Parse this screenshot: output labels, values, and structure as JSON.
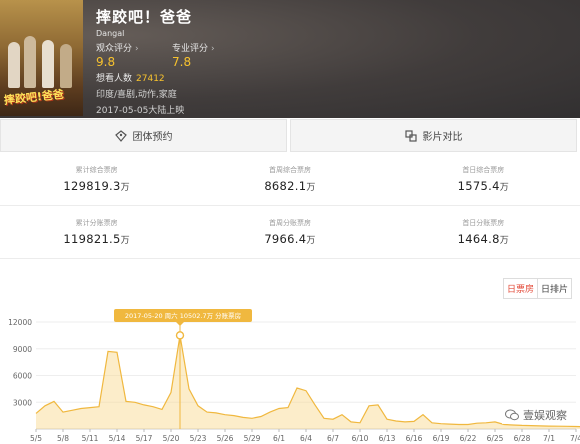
{
  "movie": {
    "title": "摔跤吧！爸爸",
    "subtitle": "Dangal",
    "audience_score_label": "观众评分",
    "audience_score": "9.8",
    "pro_score_label": "专业评分",
    "pro_score": "7.8",
    "wish_label": "想看人数",
    "wish_count": "27412",
    "genre": "印度/喜剧,动作,家庭",
    "release": "2017-05-05大陆上映",
    "poster_title": "摔跤吧!爸爸"
  },
  "actions": {
    "group_booking": "团体预约",
    "compare": "影片对比"
  },
  "stats": [
    [
      {
        "label": "累计综合票房",
        "value": "129819.3",
        "unit": "万"
      },
      {
        "label": "首周综合票房",
        "value": "8682.1",
        "unit": "万"
      },
      {
        "label": "首日综合票房",
        "value": "1575.4",
        "unit": "万"
      }
    ],
    [
      {
        "label": "累计分账票房",
        "value": "119821.5",
        "unit": "万"
      },
      {
        "label": "首周分账票房",
        "value": "7966.4",
        "unit": "万"
      },
      {
        "label": "首日分账票房",
        "value": "1464.8",
        "unit": "万"
      }
    ]
  ],
  "chart_toggle": {
    "box_office": "日票房",
    "schedule": "日排片"
  },
  "tooltip": "2017-05-20 周六 10502.7万 分账票房",
  "watermark": "壹娱观察",
  "colors": {
    "accent_red": "#e34b3a",
    "line": "#f0b83f",
    "score": "#f7c22e"
  },
  "chart_data": {
    "type": "area",
    "x_labels": [
      "5/5",
      "5/8",
      "5/11",
      "5/14",
      "5/17",
      "5/20",
      "5/23",
      "5/26",
      "5/29",
      "6/1",
      "6/4",
      "6/7",
      "6/10",
      "6/13",
      "6/16",
      "6/19",
      "6/22",
      "6/25",
      "6/28",
      "7/1",
      "7/4"
    ],
    "y_ticks": [
      0,
      3000,
      6000,
      9000,
      12000
    ],
    "ylim": [
      0,
      12000
    ],
    "series": [
      {
        "values": [
          1750,
          2600,
          3100,
          1900,
          2100,
          2300,
          2400,
          2500,
          8700,
          8600,
          3100,
          3000,
          2700,
          2500,
          2200,
          4100,
          10502.7,
          4500,
          2600,
          1900,
          1800,
          1600,
          1500,
          1300,
          1200,
          1400,
          1900,
          2300,
          2400,
          4600,
          4300,
          2700,
          1200,
          1100,
          1600,
          800,
          700,
          2600,
          2700,
          1100,
          900,
          800,
          850,
          1600,
          700,
          600,
          550,
          500,
          500,
          650,
          700,
          800,
          500,
          450,
          400,
          380,
          350,
          330,
          310,
          300,
          280,
          260,
          250,
          240,
          260,
          230,
          200,
          190,
          180,
          170,
          160,
          150,
          140,
          140,
          130,
          120,
          110,
          100,
          90,
          85,
          80,
          75,
          70,
          65,
          60,
          55,
          50,
          45,
          40,
          40,
          38,
          35
        ]
      }
    ],
    "highlight": {
      "x": "5/20",
      "value": 10502.7
    }
  }
}
